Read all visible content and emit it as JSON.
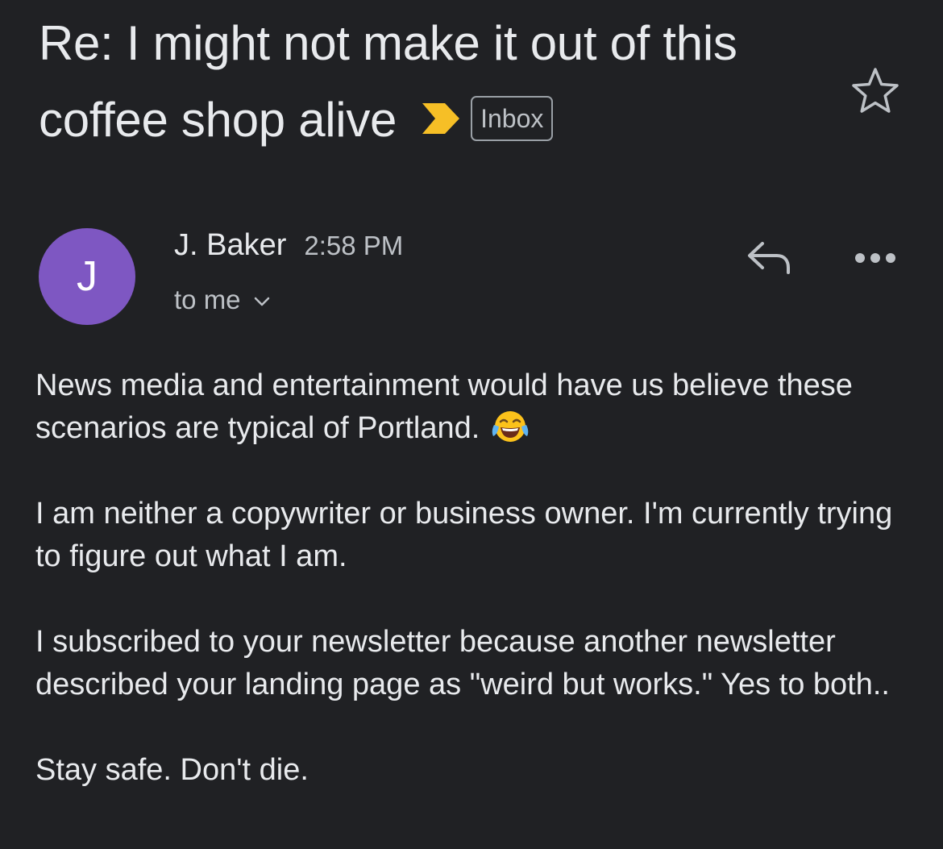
{
  "email": {
    "subject": "Re: I might not make it out of this coffee shop alive",
    "label": "Inbox",
    "sender": {
      "initial": "J",
      "name": "J. Baker",
      "time": "2:58 PM",
      "recipient": "to me"
    },
    "body": {
      "paragraph_1": "News media and entertainment would have us believe these scenarios are typical of Portland.",
      "paragraph_2": "I am neither a copywriter or business owner.  I'm currently trying to figure out what I am.",
      "paragraph_3": "I subscribed to your newsletter because another newsletter described your landing page as \"weird but works.\"    Yes to both..",
      "paragraph_4": "Stay safe. Don't die."
    }
  },
  "icons": {
    "importance": "importance-marker-icon",
    "star": "star-icon",
    "chevron": "chevron-down-icon",
    "reply": "reply-icon",
    "more": "more-options-icon",
    "emoji": "tears-of-joy-emoji-icon"
  },
  "colors": {
    "background": "#202124",
    "text": "#e8eaed",
    "secondary_text": "#bdc1c6",
    "avatar": "#7e57c2",
    "importance_marker": "#f6bf26"
  }
}
